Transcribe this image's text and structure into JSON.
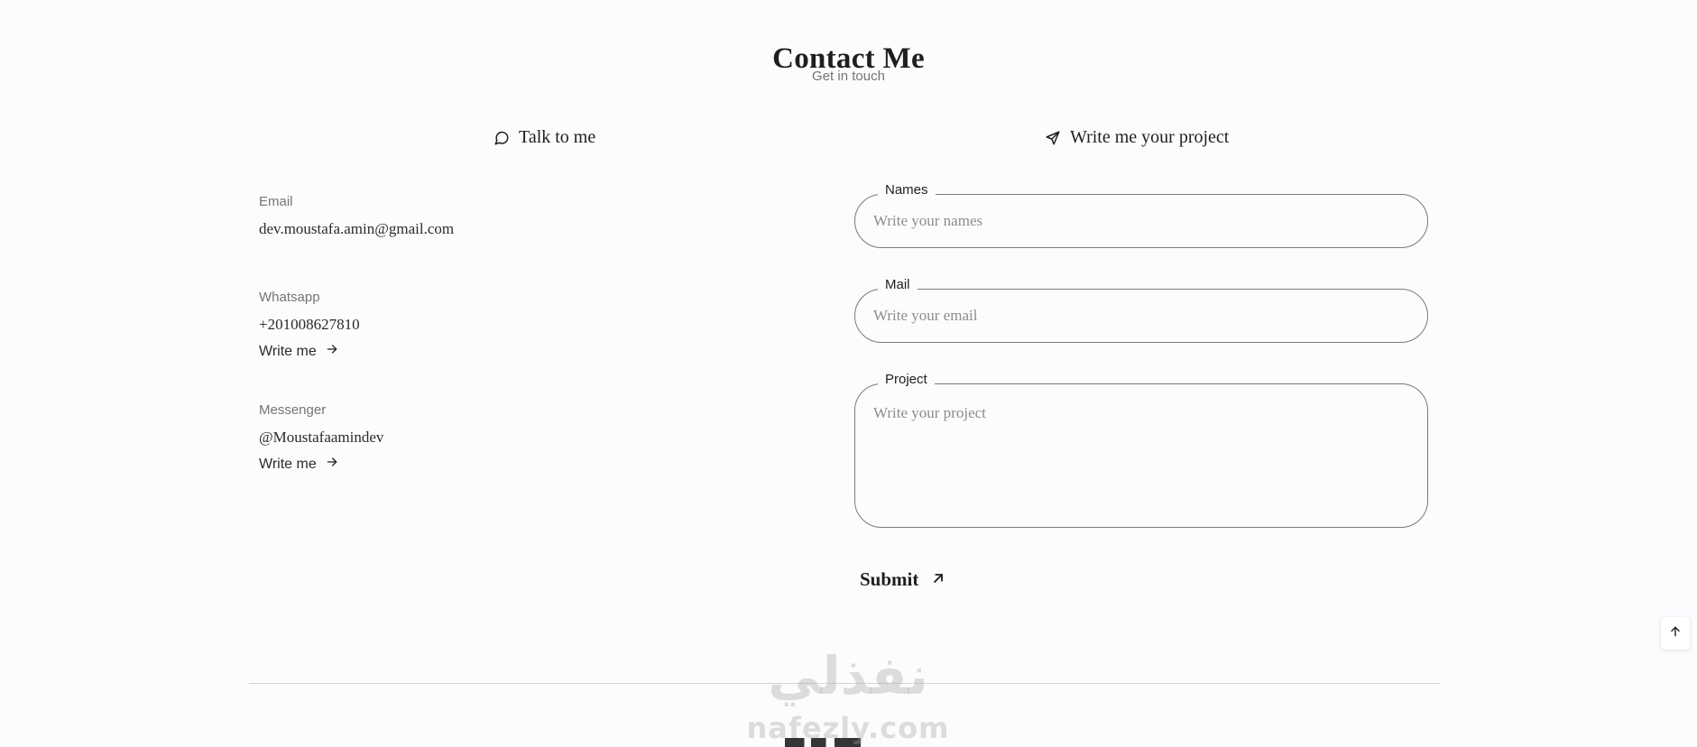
{
  "section": {
    "title": "Contact Me",
    "subtitle": "Get in touch"
  },
  "talk": {
    "heading": "Talk to me",
    "icon": "chat-bubble-icon",
    "cards": [
      {
        "label": "Email",
        "value": "dev.moustafa.amin@gmail.com"
      },
      {
        "label": "Whatsapp",
        "value": "+201008627810",
        "link": "Write me"
      },
      {
        "label": "Messenger",
        "value": "@Moustafaamindev",
        "link": "Write me"
      }
    ]
  },
  "project": {
    "heading": "Write me your project",
    "icon": "send-icon"
  },
  "form": {
    "names": {
      "label": "Names",
      "placeholder": "Write your names"
    },
    "mail": {
      "label": "Mail",
      "placeholder": "Write your email"
    },
    "project": {
      "label": "Project",
      "placeholder": "Write your project"
    },
    "submit": "Submit"
  },
  "scroll_up_icon": "arrow-up-icon",
  "watermark": {
    "arabic": "نفذلي",
    "latin": "nafezly.com"
  }
}
